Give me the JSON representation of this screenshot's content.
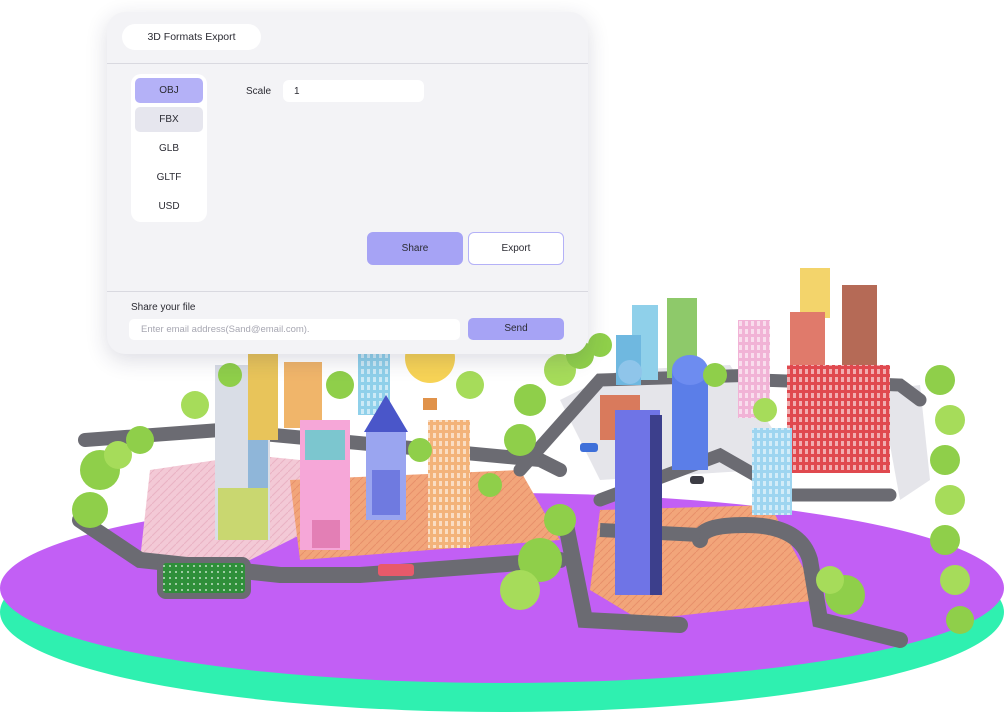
{
  "panel": {
    "title": "3D Formats Export",
    "formats": [
      "OBJ",
      "FBX",
      "GLB",
      "GLTF",
      "USD"
    ],
    "selected_format": "OBJ",
    "scale_label": "Scale",
    "scale_value": "1",
    "share_button": "Share",
    "export_button": "Export",
    "share_label": "Share your file",
    "email_placeholder": "Enter email address(Sand@email.com).",
    "send_button": "Send"
  },
  "colors": {
    "accent": "#a6a3f5",
    "selected": "#b4b1f7",
    "panel_bg": "#f3f3f6",
    "platform_top": "#c25ff5",
    "platform_edge": "#2ff0b0"
  }
}
